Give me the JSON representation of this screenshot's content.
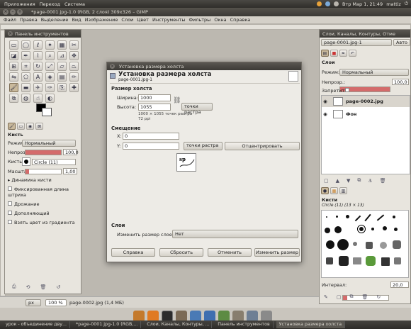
{
  "top_panel": {
    "menus": [
      "Приложения",
      "Переход",
      "Система"
    ],
    "clock": "Втр Мар 1, 21:49",
    "user": "mattiz"
  },
  "window_title": "*page-0001.jpg-1.0 (RGB, 2 слоя) 309x326 – GIMP",
  "menubar": [
    "Файл",
    "Правка",
    "Выделение",
    "Вид",
    "Изображение",
    "Слои",
    "Цвет",
    "Инструменты",
    "Фильтры",
    "Окна",
    "Справка"
  ],
  "toolbox": {
    "title": "Панель инструментов",
    "brush_section": {
      "title": "Кисть",
      "mode_label": "Режим:",
      "mode_value": "Нормальный",
      "opacity_label": "Непрозр.:",
      "opacity_value": "100,0",
      "brush_label": "Кисть:",
      "brush_value": "Circle (11)",
      "scale_label": "Масштаб:",
      "scale_value": "1,00",
      "options": [
        "Динамика кисти",
        "Фиксированная длина штриха",
        "Дрожание",
        "Дополняющий",
        "Взять цвет из градиента"
      ]
    }
  },
  "status": {
    "unit": "px",
    "zoom": "100 %",
    "file": "page-0002.jpg (1,4 МБ)"
  },
  "dialog": {
    "window_title": "Установка размера холста",
    "header_title": "Установка размера холста",
    "header_subtitle": "page-0001.jpg-1",
    "canvas_size_title": "Размер холста",
    "width_label": "Ширина:",
    "width_value": "1000",
    "height_label": "Высота:",
    "height_value": "1055",
    "unit": "точки растра",
    "size_info": "1000 × 1055 точек растра",
    "dpi_info": "72 ppi",
    "offset_title": "Смещение",
    "x_label": "X:",
    "x_value": "0",
    "y_label": "Y:",
    "y_value": "0",
    "offset_unit": "точки растра",
    "center_button": "Отцентрировать",
    "layers_title": "Слои",
    "resize_layers_label": "Изменить размер слоев:",
    "resize_layers_value": "Нет",
    "buttons": {
      "help": "Справка",
      "reset": "Сбросить",
      "cancel": "Отменить",
      "resize": "Изменить размер"
    }
  },
  "layers_panel": {
    "title": "Слои, Каналы, Контуры, Отме",
    "image_select": "page-0001.jpg-1",
    "auto": "Авто",
    "section": "Слои",
    "mode_label": "Режим:",
    "mode_value": "Нормальный",
    "opacity_label": "Непрозр.:",
    "opacity_value": "100,0",
    "lock_label": "Запретить:",
    "layers": [
      {
        "name": "page-0002.jpg"
      },
      {
        "name": "Фон"
      }
    ],
    "brushes_title": "Кисти",
    "brush_name": "Circle (11) (13 × 13)",
    "spacing_label": "Интервал:",
    "spacing_value": "20,0"
  },
  "taskbar": {
    "items": [
      "урок - объединение дву...",
      "*page-0001.jpg-1.0 (RGB,...",
      "Слои, Каналы, Контуры, ...",
      "Панель инструментов",
      "Установка размера холста"
    ]
  },
  "colors": {
    "accent": "#c9b99c",
    "slider_fill": "#d46b6b"
  }
}
